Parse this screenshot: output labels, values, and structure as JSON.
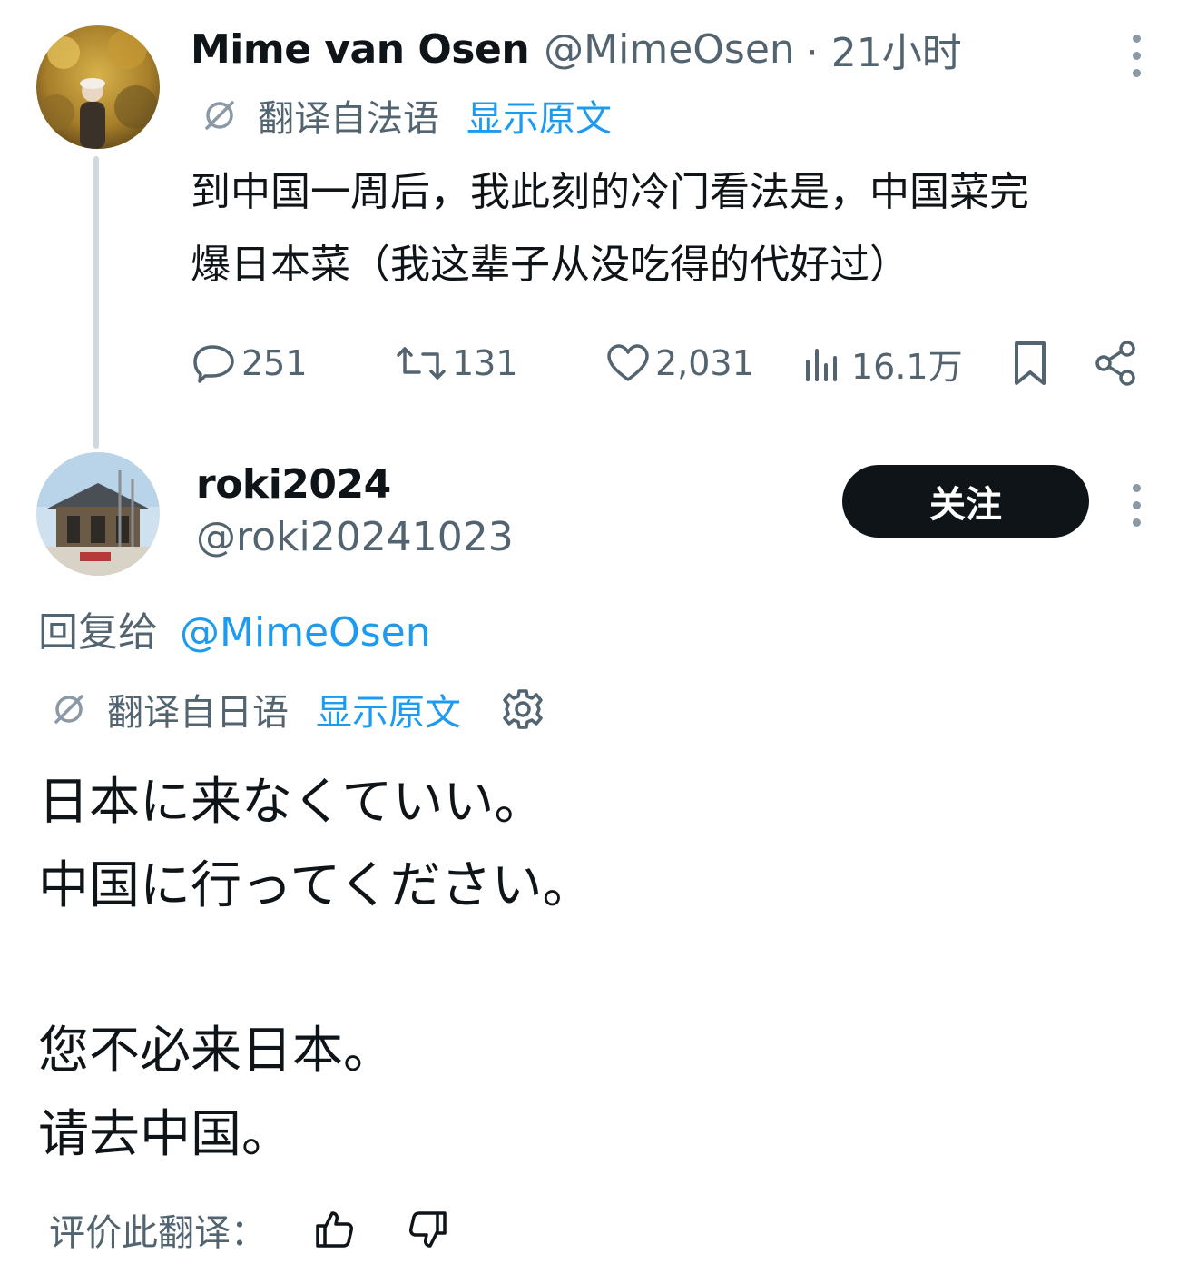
{
  "original_tweet": {
    "author_name": "Mime van Osen",
    "author_handle": "@MimeOsen",
    "time": "· 21小时",
    "translation": {
      "label": "翻译自法语",
      "show_original": "显示原文"
    },
    "text_line1": "到中国一周后，我此刻的冷门看法是，中国菜完",
    "text_line2": "爆日本菜（我这辈子从没吃得的代好过）",
    "stats": {
      "replies": "251",
      "reposts": "131",
      "likes": "2,031",
      "views": "16.1万"
    }
  },
  "reply_tweet": {
    "author_name": "roki2024",
    "author_handle": "@roki20241023",
    "follow_label": "关注",
    "reply_to_prefix": "回复给",
    "reply_to_handle": "@MimeOsen",
    "translation": {
      "label": "翻译自日语",
      "show_original": "显示原文"
    },
    "lines": [
      "日本に来なくていい。",
      "中国に行ってください。",
      "您不必来日本。",
      "请去中国。"
    ],
    "rate_label": "评价此翻译："
  },
  "colors": {
    "text": "#0f1419",
    "muted": "#536471",
    "link": "#1d9bf0",
    "button_bg": "#0f1419"
  },
  "icons": [
    "translate-icon",
    "reply-icon",
    "repost-icon",
    "like-icon",
    "views-icon",
    "bookmark-icon",
    "share-icon",
    "more-icon",
    "settings-icon",
    "thumbs-up-icon",
    "thumbs-down-icon"
  ]
}
